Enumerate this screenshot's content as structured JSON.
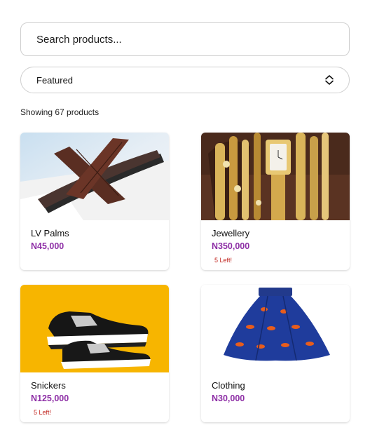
{
  "search": {
    "placeholder": "Search products..."
  },
  "sort": {
    "selected": "Featured"
  },
  "results": {
    "count_text": "Showing 67 products"
  },
  "products": [
    {
      "name": "LV Palms",
      "price": "N45,000",
      "stock": ""
    },
    {
      "name": "Jewellery",
      "price": "N350,000",
      "stock": "5 Left!"
    },
    {
      "name": "Snickers",
      "price": "N125,000",
      "stock": "5 Left!"
    },
    {
      "name": "Clothing",
      "price": "N30,000",
      "stock": ""
    }
  ],
  "colors": {
    "price": "#8e2fa6",
    "stock_warning": "#c0221c",
    "border": "#cfcfcf"
  },
  "icons": {
    "sort": "chevron-up-down-icon"
  }
}
